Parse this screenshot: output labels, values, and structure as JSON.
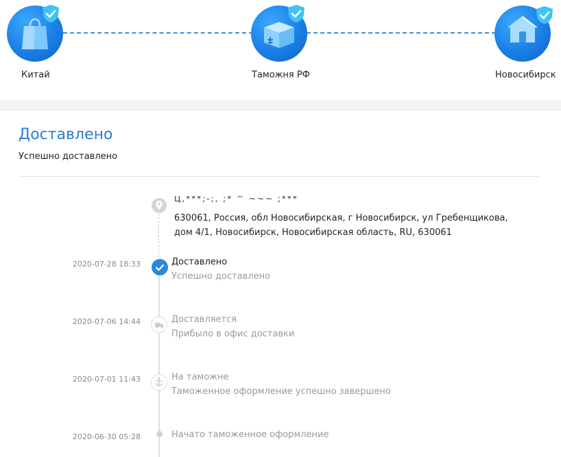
{
  "stages": [
    {
      "label": "Китай",
      "icon": "shopping-bag-icon"
    },
    {
      "label": "Таможня РФ",
      "icon": "customs-box-icon"
    },
    {
      "label": "Новосибирск",
      "icon": "house-icon"
    }
  ],
  "status": {
    "title": "Доставлено",
    "subtitle": "Успешно доставлено"
  },
  "address": {
    "recipient_masked": "Ц,***;-;,  ;* ^ ~~~ ;***",
    "lines": "630061, Россия, обл Новосибирская, г Новосибирск, ул Гребенщикова, дом 4/1,  Новосибирск,  Новосибирская область,  RU,  630061"
  },
  "events": [
    {
      "date": "2020-07-28 18:33",
      "title": "Доставлено",
      "description": "Успешно доставлено"
    },
    {
      "date": "2020-07-06 14:44",
      "title": "Доставляется",
      "description": "Прибыло в офис доставки"
    },
    {
      "date": "2020-07-01 11:43",
      "title": "На таможне",
      "description": "Таможенное оформление успешно завершено"
    },
    {
      "date": "2020-06-30 05:28",
      "title": "Начато таможенное оформление",
      "description": ""
    }
  ],
  "colors": {
    "accent": "#2a7fd0",
    "stage_blue": "#1b7fe6",
    "badge": "#3fc3f5",
    "muted_text": "#999999"
  }
}
